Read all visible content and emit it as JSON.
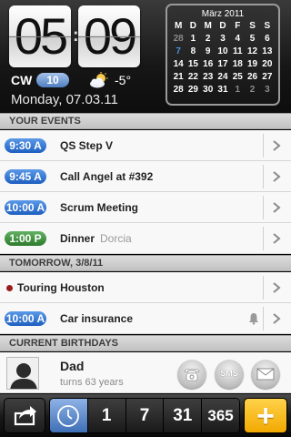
{
  "header": {
    "clock": {
      "hours": "05",
      "minutes": "09"
    },
    "cw_label": "CW",
    "cw_number": "10",
    "weather_icon": "partly-cloudy-icon",
    "temperature": "-5°",
    "date": "Monday, 07.03.11"
  },
  "mini_calendar": {
    "title": "März 2011",
    "weekdays": [
      "M",
      "D",
      "M",
      "D",
      "F",
      "S",
      "S"
    ],
    "weeks": [
      [
        "28",
        "1",
        "2",
        "3",
        "4",
        "5",
        "6"
      ],
      [
        "7",
        "8",
        "9",
        "10",
        "11",
        "12",
        "13"
      ],
      [
        "14",
        "15",
        "16",
        "17",
        "18",
        "19",
        "20"
      ],
      [
        "21",
        "22",
        "23",
        "24",
        "25",
        "26",
        "27"
      ],
      [
        "28",
        "29",
        "30",
        "31",
        "1",
        "2",
        "3"
      ]
    ]
  },
  "sections": {
    "your_events": "YOUR EVENTS",
    "tomorrow": "TOMORROW, 3/8/11",
    "birthdays": "CURRENT BIRTHDAYS"
  },
  "events": [
    {
      "time": "9:30 A",
      "title": "QS Step V",
      "subtitle": "",
      "color": "#1e5fc0"
    },
    {
      "time": "9:45 A",
      "title": "Call Angel at #392",
      "subtitle": "",
      "color": "#1e5fc0"
    },
    {
      "time": "10:00 A",
      "title": "Scrum Meeting",
      "subtitle": "",
      "color": "#1e5fc0"
    },
    {
      "time": "1:00 P",
      "title": "Dinner",
      "subtitle": "Dorcia",
      "color": "#2d7b2d"
    }
  ],
  "tomorrow_events": [
    {
      "time": "",
      "title": "Touring Houston",
      "marker_color": "#9b1b1b"
    },
    {
      "time": "10:00 A",
      "title": "Car insurance",
      "alarm_icon": "bell-icon"
    }
  ],
  "birthday": {
    "name": "Dad",
    "detail": "turns 63 years",
    "sms_label": "SMS"
  },
  "toolbar": {
    "share_icon": "share-icon",
    "views": [
      "1",
      "7",
      "31",
      "365"
    ],
    "active_view_icon": "clock-icon",
    "add_label": "+"
  }
}
